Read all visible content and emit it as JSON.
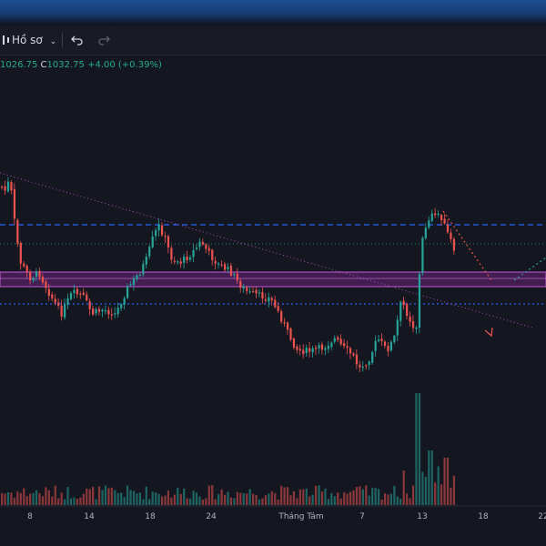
{
  "toolbar": {
    "profile_label": "Hồ sơ"
  },
  "ohlc": {
    "low_value": "1026.75",
    "close_prefix": "C",
    "close_value": "1032.75",
    "change": "+4.00 (+0.39%)"
  },
  "chart_data": {
    "type": "candlestick",
    "x_ticks": [
      "8",
      "14",
      "18",
      "24",
      "Tháng Tám",
      "7",
      "13",
      "18",
      "22"
    ],
    "colors": {
      "up": "#26a69a",
      "down": "#ef5350",
      "background": "#141720",
      "zone": "#9c27b0",
      "dashed_line": "#2962ff"
    }
  }
}
